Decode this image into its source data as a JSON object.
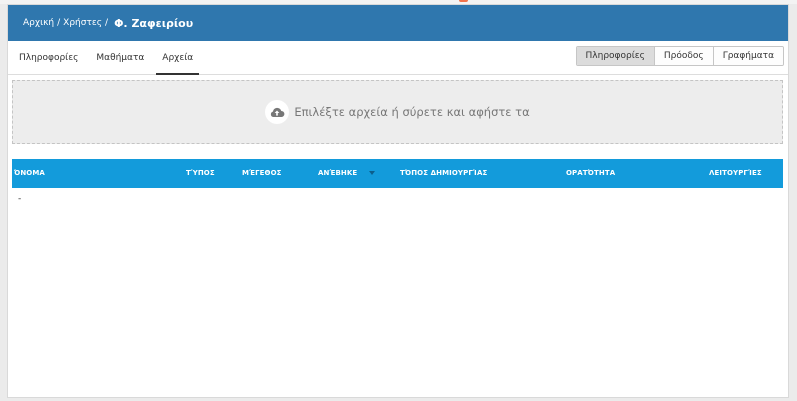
{
  "breadcrumb": {
    "home": "Αρχική",
    "users": "Χρήστες",
    "separator": "/",
    "current": "Φ. Ζαφειρίου"
  },
  "tabs": [
    {
      "label": "Πληροφορίες",
      "active": false
    },
    {
      "label": "Μαθήματα",
      "active": false
    },
    {
      "label": "Αρχεία",
      "active": true
    }
  ],
  "view_buttons": [
    {
      "label": "Πληροφορίες",
      "active": true
    },
    {
      "label": "Πρόοδος",
      "active": false
    },
    {
      "label": "Γραφήματα",
      "active": false
    }
  ],
  "dropzone": {
    "text": "Επιλέξτε αρχεία ή σύρετε και αφήστε τα",
    "icon": "cloud-upload-icon"
  },
  "table": {
    "columns": [
      "ΌΝΟΜΑ",
      "ΤΎΠΟΣ",
      "ΜΈΓΕΘΟΣ",
      "ΑΝΈΒΗΚΕ",
      "ΤΌΠΟΣ ΔΗΜΙΟΥΡΓΊΑΣ",
      "ΟΡΑΤΌΤΗΤΑ",
      "ΛΕΙΤΟΥΡΓΊΕΣ"
    ],
    "empty_value": "-"
  },
  "colors": {
    "header_bg": "#2f77ae",
    "table_header_bg": "#139bdb",
    "page_bg": "#ebebeb",
    "accent": "#f1734c"
  }
}
